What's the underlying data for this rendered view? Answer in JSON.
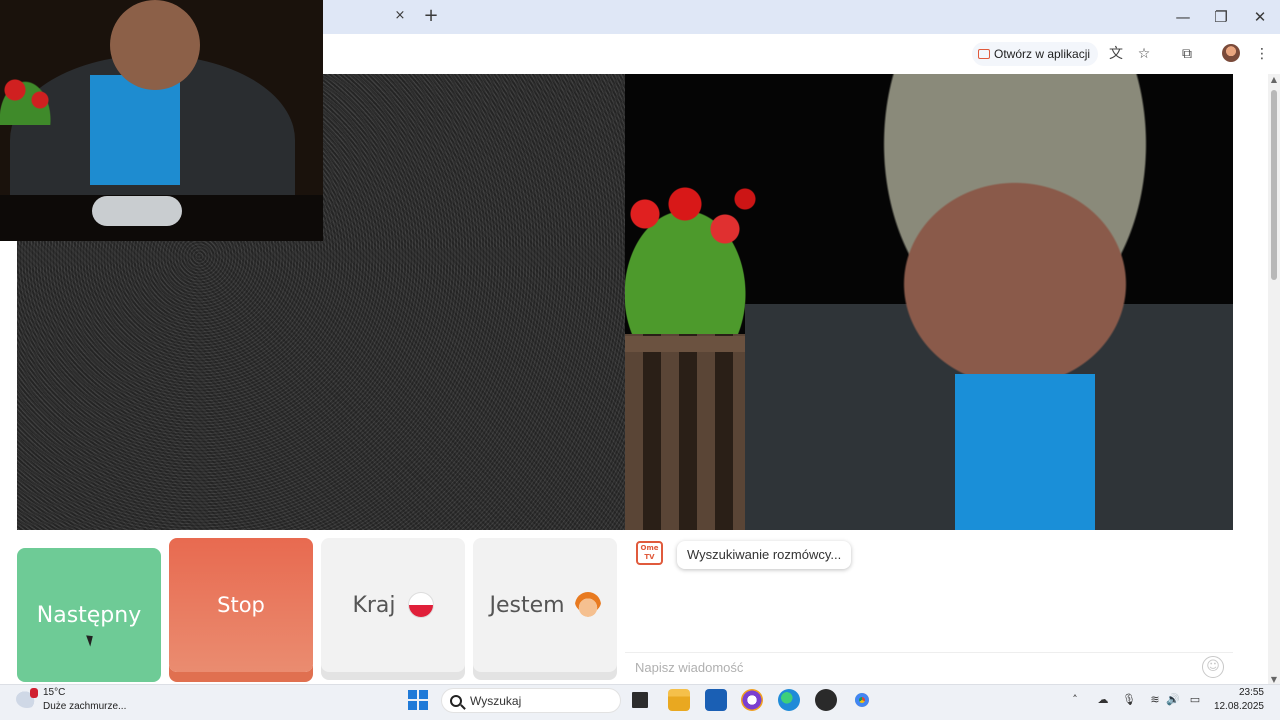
{
  "browser": {
    "tab_close": "×",
    "new_tab": "+",
    "window": {
      "minimize": "—",
      "restore": "❐",
      "close": "✕"
    },
    "toolbar": {
      "open_in_app": "Otwórz w aplikacji",
      "translate_icon": "translate-icon",
      "star_icon": "bookmark-star-icon",
      "extensions_icon": "puzzle-icon",
      "menu": "⋮"
    }
  },
  "app": {
    "buttons": {
      "next": "Następny",
      "stop": "Stop",
      "country": "Kraj",
      "gender": "Jestem"
    },
    "chat": {
      "logo_text": "Ome TV",
      "status_message": "Wyszukiwanie rozmówcy...",
      "input_placeholder": "Napisz wiadomość",
      "emoji": "☺"
    },
    "colors": {
      "next": "#6ecb96",
      "stop": "#e86a50",
      "accent": "#e05a3c"
    }
  },
  "taskbar": {
    "weather": {
      "temp": "15°C",
      "description": "Duże zachmurze..."
    },
    "search_placeholder": "Wyszukaj",
    "clock": {
      "time": "23:55",
      "date": "12.08.2025"
    }
  }
}
